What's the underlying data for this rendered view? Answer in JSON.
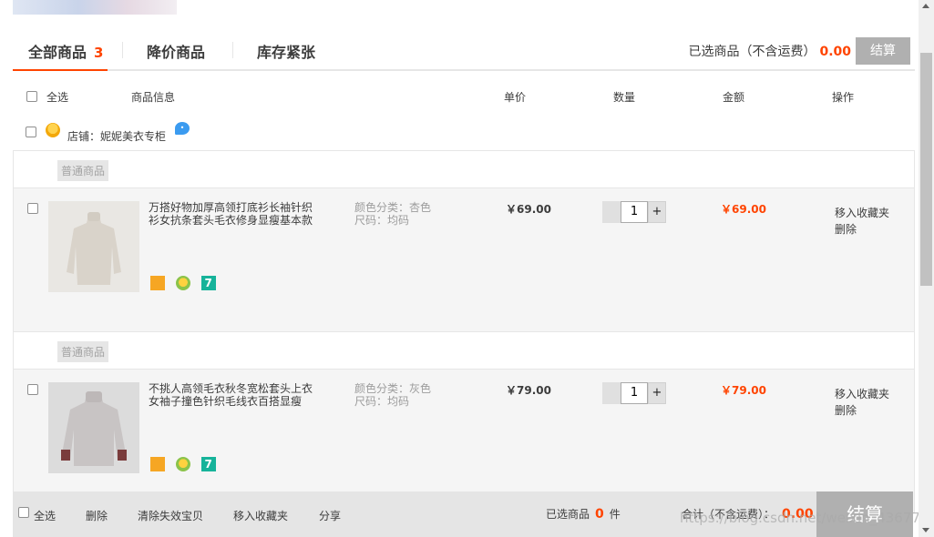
{
  "tabs": [
    {
      "label": "全部商品",
      "count": "3"
    },
    {
      "label": "降价商品"
    },
    {
      "label": "库存紧张"
    }
  ],
  "top_summary": {
    "label": "已选商品（不含运费）",
    "amount": "0.00",
    "checkout": "结算"
  },
  "header": {
    "select_all": "全选",
    "info": "商品信息",
    "unit_price": "单价",
    "quantity": "数量",
    "amount": "金额",
    "action": "操作"
  },
  "shop": {
    "label": "店铺：妮妮美衣专柜"
  },
  "items": [
    {
      "tag": "普通商品",
      "title": "万搭好物加厚高领打底衫长袖针织衫女抗条套头毛衣修身显瘦基本款",
      "color": "颜色分类：杏色",
      "size": "尺码：均码",
      "unit_price": "￥69.00",
      "qty": "1",
      "total": "￥69.00",
      "ops": [
        "移入收藏夹",
        "删除"
      ]
    },
    {
      "tag": "普通商品",
      "title": "不挑人高领毛衣秋冬宽松套头上衣女袖子撞色针织毛线衣百搭显瘦",
      "color": "颜色分类：灰色",
      "size": "尺码：均码",
      "unit_price": "￥79.00",
      "qty": "1",
      "total": "￥79.00",
      "ops": [
        "移入收藏夹",
        "删除"
      ]
    }
  ],
  "qty_plus": "+",
  "footer": {
    "select_all": "全选",
    "delete": "删除",
    "clear_invalid": "清除失效宝贝",
    "move_favorites": "移入收藏夹",
    "share": "分享",
    "selected_label": "已选商品",
    "selected_count": "0",
    "selected_unit": "件",
    "sum_label": "合计（不含运费）：",
    "sum_amount": "0.00",
    "checkout": "结算"
  },
  "watermark": "https://blog.csdn.net/weixin_43677567",
  "colors": {
    "accent": "#ff4400",
    "checkout_disabled": "#b0b0b0"
  }
}
